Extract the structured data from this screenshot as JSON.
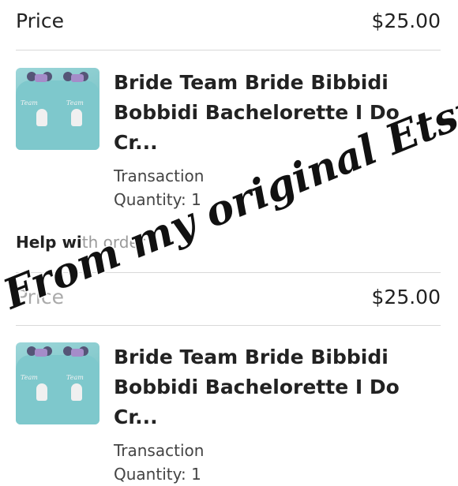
{
  "section1": {
    "price_label": "Price",
    "price_value": "$25.00",
    "item": {
      "title_line1": "Bride Team Bride Bibbidi",
      "title_line2": "Bobbidi Bachelorette I Do Cr...",
      "type": "Transaction",
      "quantity": "Quantity: 1"
    }
  },
  "help": {
    "label_part1": "Help wi",
    "label_part2": "th order"
  },
  "section2": {
    "price_label": "Price",
    "price_value": "$25.00",
    "item": {
      "title_line1": "Bride Team Bride Bibbidi",
      "title_line2": "Bobbidi Bachelorette I Do Cr...",
      "type": "Transaction",
      "quantity": "Quantity: 1"
    }
  },
  "overlay": {
    "handwriting": "From my original Etsy order",
    "ink_color": "#111111"
  }
}
